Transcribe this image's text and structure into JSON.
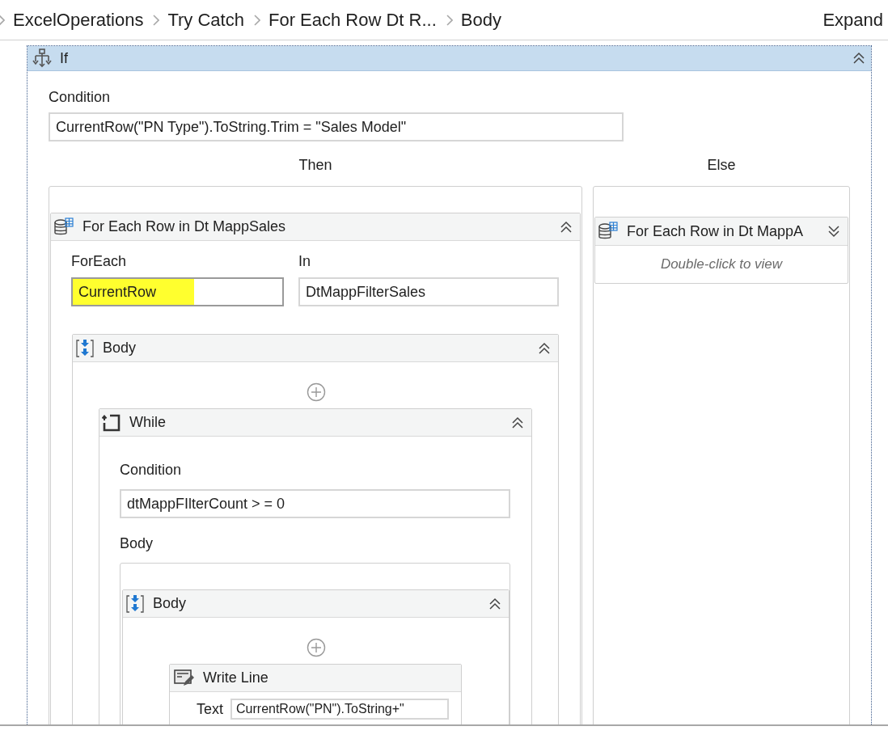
{
  "breadcrumb": [
    {
      "label": "ExcelOperations"
    },
    {
      "label": "Try Catch"
    },
    {
      "label": "For Each Row Dt R..."
    },
    {
      "label": "Body"
    }
  ],
  "expand_link": "Expand",
  "if_activity": {
    "title": "If",
    "expanded": true,
    "condition_label": "Condition",
    "condition": "CurrentRow(\"PN Type\").ToString.Trim = \"Sales Model\"",
    "then_label": "Then",
    "else_label": "Else",
    "then": {
      "title": "For Each Row in Dt MappSales",
      "expanded": true,
      "foreach_label": "ForEach",
      "foreach_value": "CurrentRow",
      "foreach_highlighted": true,
      "in_label": "In",
      "in_value": "DtMappFilterSales",
      "body": {
        "title": "Body",
        "expanded": true,
        "while": {
          "title": "While",
          "expanded": true,
          "condition_label": "Condition",
          "condition": "dtMappFIlterCount > = 0",
          "body_label": "Body",
          "body": {
            "title": "Body",
            "expanded": true,
            "write_line": {
              "title": "Write Line",
              "text_label": "Text",
              "text_value": "CurrentRow(\"PN\").ToString+\""
            }
          }
        }
      }
    },
    "else": {
      "title": "For Each Row in Dt MappA",
      "expanded": false,
      "hint": "Double-click to view"
    }
  }
}
